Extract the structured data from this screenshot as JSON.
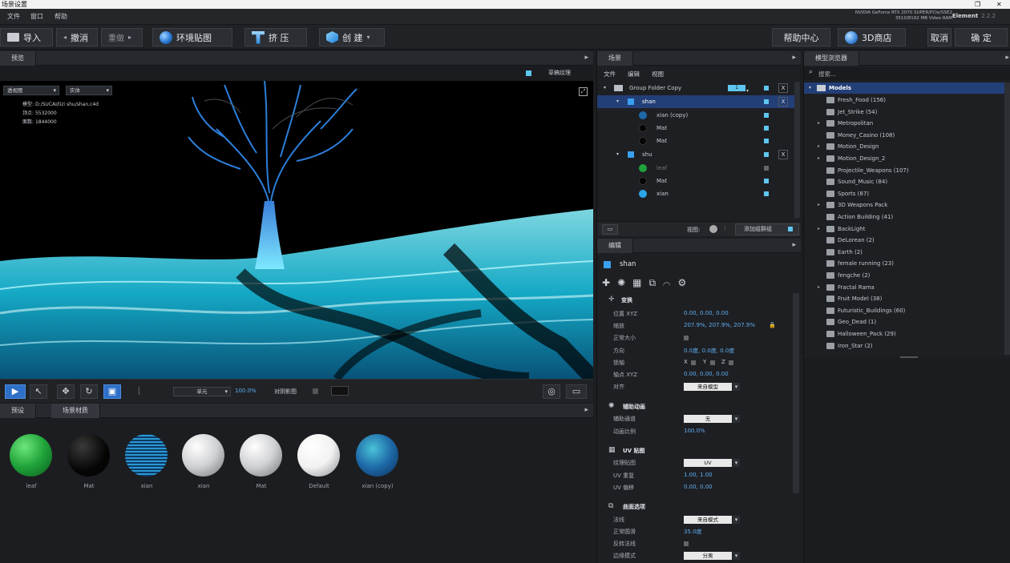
{
  "window": {
    "title": "场景设置"
  },
  "menu": {
    "file": "文件",
    "window": "窗口",
    "help": "帮助"
  },
  "gpu": {
    "line1": "NVIDIA GeForce RTX 2070 SUPER/PCIe/SSE2",
    "line2": "3510/8192 MB Video RAM"
  },
  "app": {
    "name": "Element",
    "version": "2.2.2"
  },
  "toolbar": {
    "import": "导入",
    "undo": "撤消",
    "redo": "重做",
    "env_map": "环境贴图",
    "extrude": "挤 压",
    "create": "创 建",
    "help_center": "帮助中心",
    "store": "3D商店",
    "cancel": "取消",
    "ok": "确 定"
  },
  "preview_panel": {
    "tab": "预览",
    "render_texture": "草稿纹理",
    "view_select": "透视图",
    "shading_select": "实体",
    "info": {
      "model_label": "模型:",
      "model_value": "D:/SUCAI/lizi shu/shan.c4d",
      "vertices_label": "顶点:",
      "vertices_value": "5532000",
      "faces_label": "面数:",
      "faces_value": "1844000"
    },
    "unit_select": "单元",
    "zoom": "100.0%",
    "bake_label": "对阴影图"
  },
  "materials_panel": {
    "tabs": [
      "预设",
      "场景材质"
    ],
    "items": [
      {
        "label": "leaf",
        "color": "#1fa33a"
      },
      {
        "label": "Mat",
        "color": "#050505"
      },
      {
        "label": "xian",
        "color": "#2aa7e8"
      },
      {
        "label": "xian",
        "color": "#cfd0d2"
      },
      {
        "label": "Mat",
        "color": "#cfd0d2"
      },
      {
        "label": "Default",
        "color": "#f2f2f2"
      },
      {
        "label": "xian (copy)",
        "color": "#1e6aa8"
      }
    ]
  },
  "scene_panel": {
    "tab": "场景",
    "menu": [
      "文件",
      "编辑",
      "视图"
    ],
    "rows": [
      {
        "label": "Group Folder Copy",
        "type": "folder",
        "indent": 0
      },
      {
        "label": "shan",
        "type": "object",
        "indent": 1
      },
      {
        "label": "xian (copy)",
        "type": "mat-blue",
        "indent": 2
      },
      {
        "label": "Mat",
        "type": "mat-black",
        "indent": 2
      },
      {
        "label": "Mat",
        "type": "mat-black",
        "indent": 2
      },
      {
        "label": "shu",
        "type": "object",
        "indent": 1
      },
      {
        "label": "leaf",
        "type": "mat-green",
        "indent": 2
      },
      {
        "label": "Mat",
        "type": "mat-black",
        "indent": 2
      },
      {
        "label": "xian",
        "type": "mat-blue",
        "indent": 2
      }
    ],
    "footer_view": "视图:",
    "add_group": "添加组群组",
    "group_badge": "1"
  },
  "edit_panel": {
    "tab": "编辑",
    "object": "shan",
    "transform": {
      "title": "变换",
      "position_label": "位置 XYZ",
      "position_value": "0.00, 0.00, 0.00",
      "scale_label": "缩放",
      "scale_value": "207.9%, 207.9%, 207.9%",
      "uniform_label": "正常大小",
      "rotation_label": "方向",
      "rotation_value": "0.0度, 0.0度, 0.0度",
      "lock_label": "锁轴",
      "xyz": [
        "X",
        "Y",
        "Z"
      ],
      "anchor_label": "轴点 XYZ",
      "anchor_value": "0.00, 0.00, 0.00",
      "align_label": "对齐",
      "align_value": "来自模型"
    },
    "aux": {
      "title": "辅助动画",
      "channel_label": "辅助通道",
      "channel_value": "无",
      "ratio_label": "动画比例",
      "ratio_value": "100.0%"
    },
    "uv": {
      "title": "UV 贴图",
      "tex_label": "纹理贴图",
      "tex_value": "UV",
      "repeat_label": "UV 重复",
      "repeat_value": "1.00, 1.00",
      "offset_label": "UV 偏移",
      "offset_value": "0.00, 0.00"
    },
    "surface": {
      "title": "曲面选项",
      "normal_label": "法线",
      "normal_value": "来自模式",
      "smooth_label": "正常圆滑",
      "smooth_value": "35.0度",
      "flip_label": "反转法线",
      "edge_label": "边缘模式",
      "edge_value": "分离"
    }
  },
  "browser_panel": {
    "tab": "模型浏览器",
    "search_placeholder": "搜索...",
    "root": "Models",
    "items": [
      {
        "label": "Fresh_Food (156)",
        "expand": false
      },
      {
        "label": "Jet_Strike (54)",
        "expand": false
      },
      {
        "label": "Metropolitan",
        "expand": true
      },
      {
        "label": "Money_Casino (108)",
        "expand": false
      },
      {
        "label": "Motion_Design",
        "expand": true
      },
      {
        "label": "Motion_Design_2",
        "expand": true
      },
      {
        "label": "Projectile_Weapons (107)",
        "expand": false
      },
      {
        "label": "Sound_Music (84)",
        "expand": false
      },
      {
        "label": "Sports (87)",
        "expand": false
      },
      {
        "label": "3D Weapons Pack",
        "expand": true
      },
      {
        "label": "Action Building (41)",
        "expand": false
      },
      {
        "label": "BackLight",
        "expand": true
      },
      {
        "label": "DeLorean (2)",
        "expand": false
      },
      {
        "label": "Earth (2)",
        "expand": false
      },
      {
        "label": "female running (23)",
        "expand": false
      },
      {
        "label": "fengche (2)",
        "expand": false
      },
      {
        "label": "Fractal Rama",
        "expand": true
      },
      {
        "label": "Fruit Model (38)",
        "expand": false
      },
      {
        "label": "Futuristic_Buildings (60)",
        "expand": false
      },
      {
        "label": "Geo_Dead (1)",
        "expand": false
      },
      {
        "label": "Halloween_Pack (29)",
        "expand": false
      },
      {
        "label": "Iron_Star (2)",
        "expand": false
      }
    ]
  }
}
